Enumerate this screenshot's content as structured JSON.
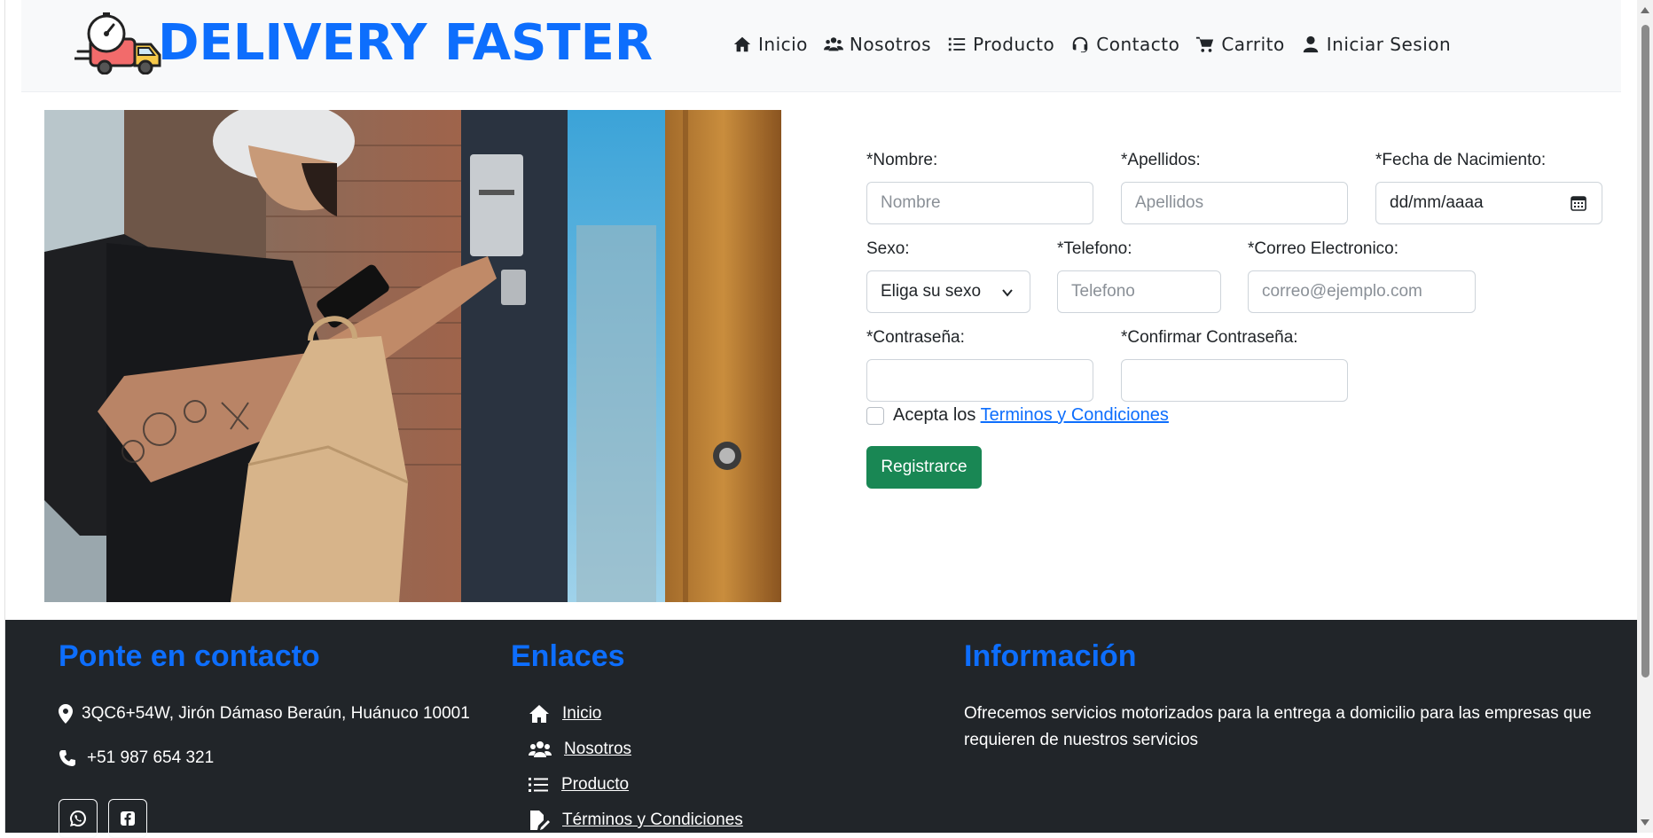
{
  "brand": {
    "name": "DELIVERY FASTER"
  },
  "nav": {
    "items": [
      {
        "label": "Inicio",
        "icon": "home-icon"
      },
      {
        "label": "Nosotros",
        "icon": "users-icon"
      },
      {
        "label": "Producto",
        "icon": "list-icon"
      },
      {
        "label": "Contacto",
        "icon": "headset-icon"
      },
      {
        "label": "Carrito",
        "icon": "cart-icon"
      },
      {
        "label": "Iniciar Sesion",
        "icon": "user-icon"
      }
    ]
  },
  "form": {
    "nombre": {
      "label": "*Nombre:",
      "placeholder": "Nombre"
    },
    "apellidos": {
      "label": "*Apellidos:",
      "placeholder": "Apellidos"
    },
    "fecha": {
      "label": "*Fecha de Nacimiento:",
      "placeholder": "dd/mm/aaaa"
    },
    "sexo": {
      "label": "Sexo:",
      "selected": "Eliga su sexo"
    },
    "telefono": {
      "label": "*Telefono:",
      "placeholder": "Telefono"
    },
    "correo": {
      "label": "*Correo Electronico:",
      "placeholder": "correo@ejemplo.com"
    },
    "contrasena": {
      "label": "*Contraseña:"
    },
    "confirmar": {
      "label": "*Confirmar Contraseña:"
    },
    "terms_prefix": "Acepta los",
    "terms_link": "Terminos y Condiciones",
    "submit": "Registrarce"
  },
  "footer": {
    "contact": {
      "title": "Ponte en contacto",
      "address": "3QC6+54W, Jirón Dámaso Beraún, Huánuco 10001",
      "phone": "+51 987 654 321"
    },
    "links": {
      "title": "Enlaces",
      "items": [
        "Inicio",
        "Nosotros",
        "Producto",
        "Términos y Condiciones"
      ]
    },
    "info": {
      "title": "Información",
      "text": "Ofrecemos servicios motorizados para la entrega a domicilio para las empresas que requieren de nuestros servicios"
    }
  },
  "colors": {
    "brand": "#0d6efd",
    "submit": "#198754",
    "footer_bg": "#212529",
    "header_bg": "#f8f9fa"
  }
}
